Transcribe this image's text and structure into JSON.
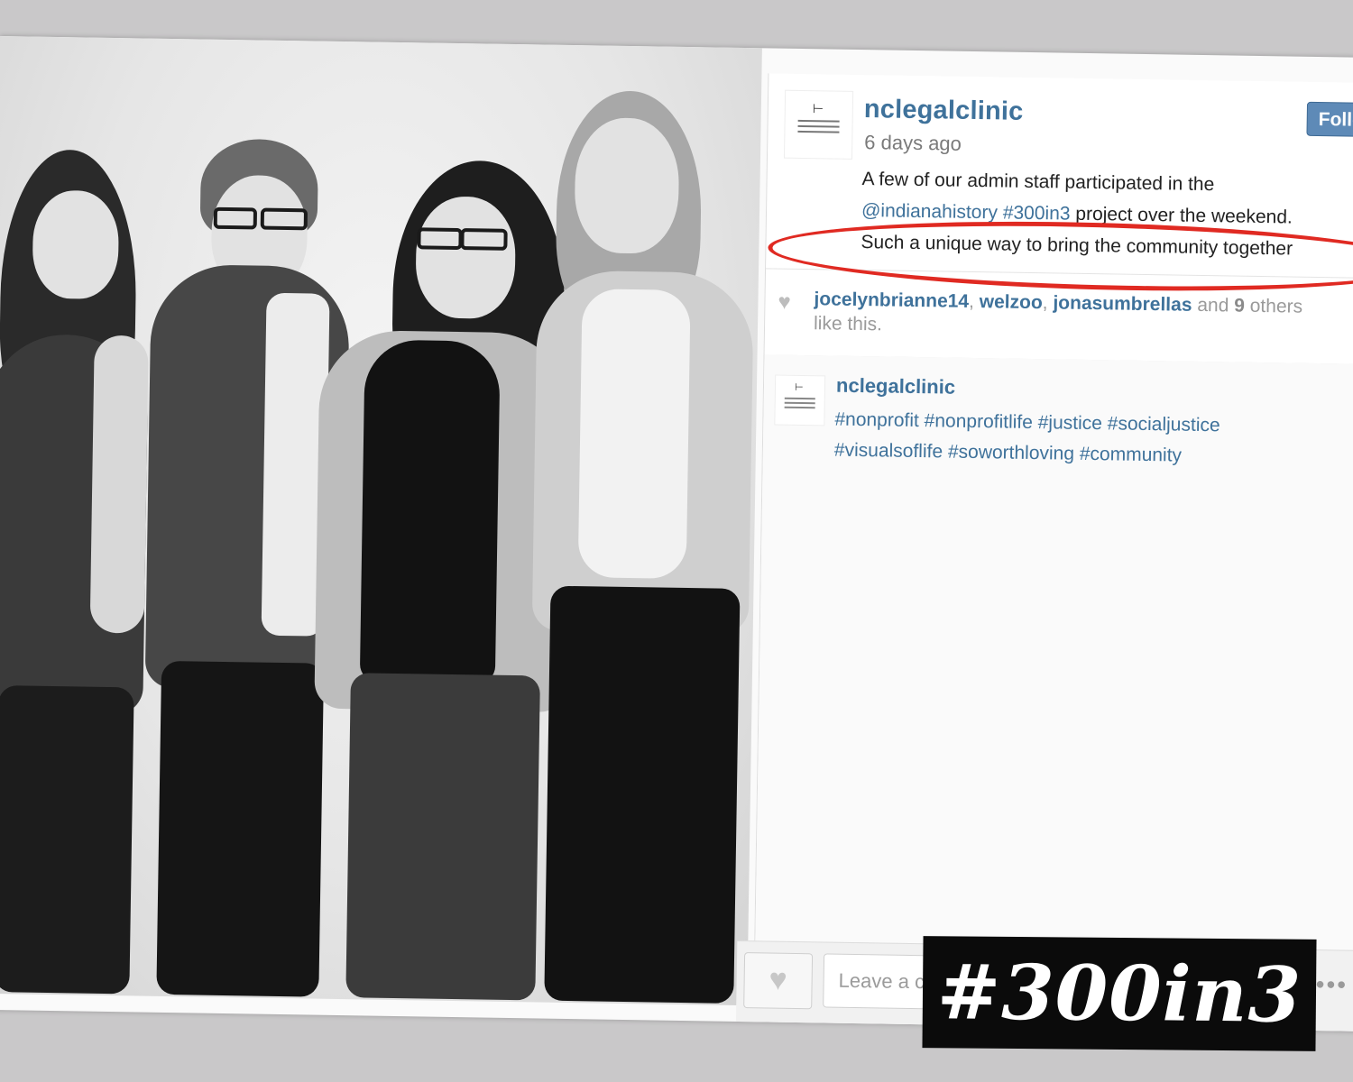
{
  "post": {
    "username": "nclegalclinic",
    "time_ago": "6 days ago",
    "follow_label": "Follow",
    "caption": {
      "line1": "A few of our admin staff participated in the",
      "mention": "@indianahistory",
      "hashtag": "#300in3",
      "line2_rest": " project over the weekend.",
      "line3": "Such a unique way to bring the community together"
    }
  },
  "likes": {
    "users": [
      "jocelynbrianne14",
      "welzoo",
      "jonasumbrellas"
    ],
    "and_label": "and",
    "count": "9",
    "others_label": "others",
    "like_this": "like this."
  },
  "comment": {
    "username": "nclegalclinic",
    "hashtags_line1": "#nonprofit #nonprofitlife #justice #socialjustice",
    "hashtags_line2": "#visualsoflife #soworthloving #community"
  },
  "footer": {
    "comment_placeholder": "Leave a comment...",
    "more_label": "•••"
  },
  "overlay": {
    "tag": "#300in3"
  },
  "colors": {
    "link": "#3f729b",
    "annotation": "#e02a22",
    "follow_button": "#5e8ab7"
  }
}
